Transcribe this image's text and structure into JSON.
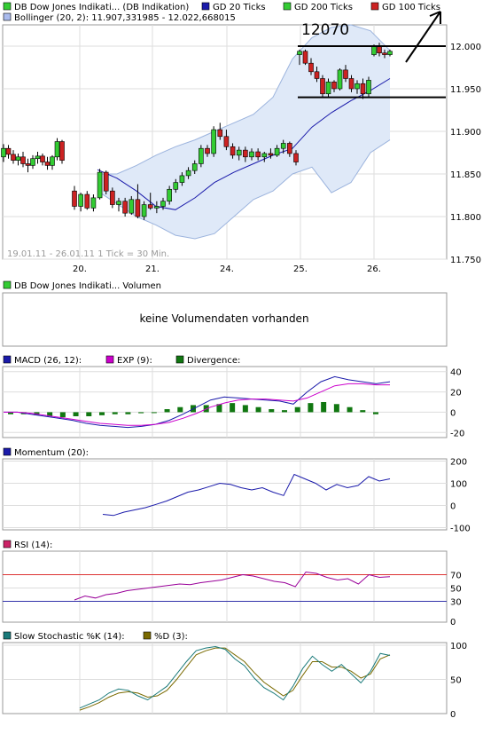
{
  "legend": {
    "main": "DB Dow Jones Indikati... (DB Indikation)",
    "gd20": "GD 20 Ticks",
    "gd200": "GD 200 Ticks",
    "gd100": "GD 100 Ticks",
    "bollinger": "Bollinger (20, 2): 11.907,331985 - 12.022,668015"
  },
  "annotation": "12070",
  "colors": {
    "up": "#33cc33",
    "down": "#cc2222",
    "gd20": "#1a1aaa",
    "band_fill": "#dfe9f8",
    "band_line": "#9bb3dd",
    "exp": "#cc00cc",
    "divergence": "#117711",
    "rsi70": "#dd3333",
    "rsi30": "#3333aa",
    "stoch_d": "#7a6a00",
    "stoch_k": "#1a7a7a"
  },
  "price_panel": {
    "period_note": "19.01.11 - 26.01.11   1 Tick = 30 Min.",
    "y_ticks": [
      "12.000",
      "11.950",
      "11.900",
      "11.850",
      "11.800",
      "11.750"
    ],
    "x_ticks": [
      "20.",
      "21.",
      "24.",
      "25.",
      "26."
    ],
    "support": 11940,
    "resistance": 12000
  },
  "volume_panel": {
    "title": "DB Dow Jones Indikati... Volumen",
    "message": "keine Volumendaten vorhanden"
  },
  "macd_panel": {
    "label_macd": "MACD (26, 12):",
    "label_exp": "EXP (9):",
    "label_div": "Divergence:",
    "y_ticks": [
      "40",
      "20",
      "0",
      "-20"
    ]
  },
  "momentum_panel": {
    "label": "Momentum (20):",
    "y_ticks": [
      "200",
      "100",
      "0",
      "-100"
    ]
  },
  "rsi_panel": {
    "label": "RSI (14):",
    "y_ticks": [
      "70",
      "50",
      "30",
      "0"
    ]
  },
  "stoch_panel": {
    "label_k": "Slow Stochastic %K (14):",
    "label_d": "%D (3):",
    "y_ticks": [
      "100",
      "50",
      "0"
    ]
  },
  "chart_data": [
    {
      "type": "candlestick",
      "title": "DB Dow Jones Indikati... (DB Indikation)",
      "ylim": [
        11750,
        12025
      ],
      "x_labels": [
        "20.",
        "21.",
        "24.",
        "25.",
        "26."
      ],
      "ohlc": [
        [
          11870,
          11885,
          11864,
          11880
        ],
        [
          11880,
          11884,
          11868,
          11873
        ],
        [
          11873,
          11878,
          11862,
          11866
        ],
        [
          11866,
          11874,
          11860,
          11870
        ],
        [
          11870,
          11876,
          11858,
          11862
        ],
        [
          11862,
          11868,
          11852,
          11860
        ],
        [
          11860,
          11872,
          11856,
          11868
        ],
        [
          11868,
          11876,
          11862,
          11871
        ],
        [
          11871,
          11874,
          11860,
          11864
        ],
        [
          11864,
          11870,
          11855,
          11860
        ],
        [
          11860,
          11872,
          11855,
          11870
        ],
        [
          11870,
          11892,
          11866,
          11888
        ],
        [
          11888,
          11890,
          11862,
          11866
        ],
        [
          11830,
          11836,
          11808,
          11812
        ],
        [
          11812,
          11828,
          11806,
          11826
        ],
        [
          11826,
          11830,
          11808,
          11810
        ],
        [
          11810,
          11826,
          11806,
          11822
        ],
        [
          11822,
          11856,
          11820,
          11852
        ],
        [
          11852,
          11854,
          11826,
          11830
        ],
        [
          11830,
          11834,
          11810,
          11814
        ],
        [
          11814,
          11822,
          11806,
          11818
        ],
        [
          11818,
          11822,
          11800,
          11804
        ],
        [
          11804,
          11824,
          11802,
          11820
        ],
        [
          11820,
          11838,
          11798,
          11800
        ],
        [
          11800,
          11818,
          11796,
          11814
        ],
        [
          11814,
          11828,
          11808,
          11810
        ],
        [
          11810,
          11818,
          11804,
          11812
        ],
        [
          11812,
          11822,
          11808,
          11818
        ],
        [
          11818,
          11836,
          11814,
          11832
        ],
        [
          11832,
          11844,
          11828,
          11840
        ],
        [
          11840,
          11852,
          11836,
          11848
        ],
        [
          11848,
          11858,
          11844,
          11854
        ],
        [
          11854,
          11866,
          11850,
          11862
        ],
        [
          11862,
          11884,
          11858,
          11880
        ],
        [
          11880,
          11884,
          11870,
          11874
        ],
        [
          11874,
          11906,
          11870,
          11902
        ],
        [
          11902,
          11910,
          11890,
          11894
        ],
        [
          11894,
          11902,
          11878,
          11882
        ],
        [
          11882,
          11886,
          11868,
          11872
        ],
        [
          11872,
          11882,
          11866,
          11878
        ],
        [
          11878,
          11882,
          11864,
          11870
        ],
        [
          11870,
          11880,
          11866,
          11876
        ],
        [
          11876,
          11880,
          11866,
          11870
        ],
        [
          11870,
          11876,
          11864,
          11874
        ],
        [
          11874,
          11880,
          11868,
          11872
        ],
        [
          11872,
          11884,
          11870,
          11880
        ],
        [
          11880,
          11890,
          11874,
          11886
        ],
        [
          11886,
          11888,
          11870,
          11874
        ],
        [
          11874,
          11878,
          11860,
          11864
        ],
        [
          11990,
          11996,
          11978,
          11994
        ],
        [
          11994,
          11996,
          11978,
          11980
        ],
        [
          11980,
          11986,
          11966,
          11970
        ],
        [
          11970,
          11976,
          11958,
          11962
        ],
        [
          11962,
          11966,
          11940,
          11944
        ],
        [
          11944,
          11962,
          11940,
          11958
        ],
        [
          11958,
          11960,
          11946,
          11950
        ],
        [
          11950,
          11974,
          11948,
          11972
        ],
        [
          11972,
          11978,
          11958,
          11962
        ],
        [
          11962,
          11966,
          11946,
          11950
        ],
        [
          11950,
          11960,
          11944,
          11956
        ],
        [
          11956,
          11962,
          11938,
          11944
        ],
        [
          11944,
          11964,
          11940,
          11960
        ],
        [
          11990,
          12002,
          11988,
          12000
        ],
        [
          12000,
          12004,
          11988,
          11992
        ],
        [
          11992,
          11996,
          11986,
          11990
        ],
        [
          11990,
          11996,
          11988,
          11994
        ]
      ],
      "bollinger_upper": [
        11850,
        11850,
        11860,
        11872,
        11882,
        11890,
        11900,
        11910,
        11920,
        11940,
        11985,
        12010,
        12022,
        12025,
        12018,
        11995
      ],
      "bollinger_lower": [
        11830,
        11815,
        11800,
        11790,
        11778,
        11774,
        11780,
        11800,
        11820,
        11830,
        11850,
        11858,
        11828,
        11840,
        11875,
        11890
      ],
      "gd20": [
        11855,
        11845,
        11830,
        11812,
        11808,
        11822,
        11840,
        11852,
        11862,
        11872,
        11880,
        11905,
        11922,
        11936,
        11948,
        11962
      ]
    },
    {
      "type": "bar+line",
      "title": "MACD (26, 12)",
      "ylim": [
        -20,
        40
      ],
      "macd": [
        0,
        0,
        -2,
        -4,
        -6,
        -8,
        -11,
        -13,
        -14,
        -15,
        -14,
        -12,
        -8,
        -2,
        5,
        12,
        15,
        14,
        13,
        12,
        11,
        8,
        20,
        30,
        35,
        32,
        30,
        28,
        30
      ],
      "exp": [
        0,
        0,
        -1,
        -3,
        -5,
        -7,
        -9,
        -11,
        -12,
        -13,
        -13,
        -12,
        -10,
        -6,
        -1,
        5,
        9,
        12,
        13,
        13,
        12,
        11,
        14,
        20,
        26,
        28,
        28,
        27,
        27
      ],
      "divergence": [
        -2,
        -2,
        -3,
        -4,
        -5,
        -4,
        -4,
        -3,
        -2,
        -2,
        -1,
        0,
        3,
        5,
        7,
        7,
        8,
        9,
        7,
        5,
        3,
        2,
        5,
        9,
        10,
        8,
        5,
        2,
        -2
      ]
    },
    {
      "type": "line",
      "title": "Momentum (20)",
      "ylim": [
        -100,
        200
      ],
      "values": [
        -40,
        -45,
        -30,
        -20,
        -10,
        5,
        20,
        40,
        60,
        70,
        85,
        100,
        95,
        80,
        70,
        80,
        60,
        45,
        140,
        120,
        100,
        70,
        95,
        80,
        90,
        130,
        110,
        120
      ]
    },
    {
      "type": "line",
      "title": "RSI (14)",
      "ylim": [
        0,
        100
      ],
      "values": [
        32,
        38,
        35,
        40,
        42,
        46,
        48,
        50,
        52,
        54,
        56,
        55,
        58,
        60,
        62,
        66,
        70,
        68,
        64,
        60,
        58,
        52,
        74,
        72,
        66,
        62,
        64,
        56,
        70,
        66,
        67
      ]
    },
    {
      "type": "line",
      "title": "Slow Stochastic %K (14)",
      "ylim": [
        0,
        100
      ],
      "k": [
        8,
        14,
        20,
        30,
        36,
        34,
        26,
        20,
        30,
        40,
        58,
        76,
        92,
        96,
        98,
        94,
        80,
        70,
        52,
        38,
        30,
        20,
        40,
        66,
        84,
        72,
        62,
        72,
        58,
        45,
        62,
        88,
        85
      ],
      "d": [
        5,
        10,
        16,
        24,
        30,
        32,
        30,
        24,
        26,
        34,
        50,
        68,
        86,
        92,
        96,
        96,
        86,
        76,
        60,
        46,
        36,
        26,
        34,
        56,
        76,
        76,
        68,
        68,
        62,
        52,
        58,
        80,
        86
      ]
    }
  ]
}
